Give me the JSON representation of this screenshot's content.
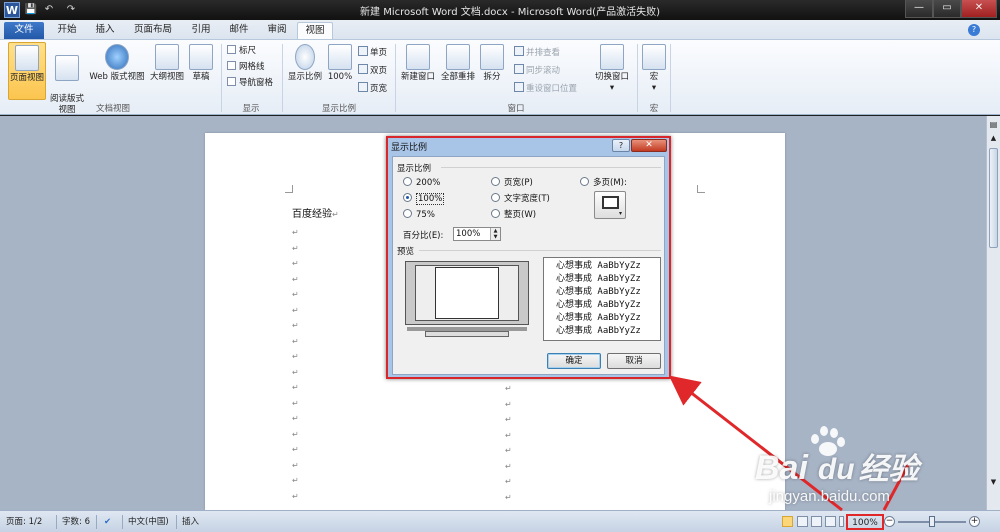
{
  "window": {
    "title": "新建 Microsoft Word 文档.docx - Microsoft Word(产品激活失败)"
  },
  "quick_access": {
    "logo": "W",
    "save": "💾",
    "undo": "↶",
    "redo": "↷"
  },
  "tabs": [
    "文件",
    "开始",
    "插入",
    "页面布局",
    "引用",
    "邮件",
    "审阅",
    "视图"
  ],
  "ribbon": {
    "doc_views": {
      "label": "文档视图",
      "buttons": [
        "页面视图",
        "阅读版式\n视图",
        "Web 版式视图",
        "大纲视图",
        "草稿"
      ]
    },
    "show": {
      "label": "显示",
      "checks": [
        "标尺",
        "网格线",
        "导航窗格"
      ]
    },
    "zoom": {
      "label": "显示比例",
      "zoom_btn": "显示比例",
      "hundred_btn": "100%",
      "small": [
        "单页",
        "双页",
        "页宽"
      ]
    },
    "window": {
      "label": "窗口",
      "buttons": [
        "新建窗口",
        "全部重排",
        "拆分"
      ],
      "small": [
        "并排查看",
        "同步滚动",
        "重设窗口位置"
      ],
      "switch": "切换窗口"
    },
    "macro": {
      "label": "宏",
      "button": "宏"
    }
  },
  "document": {
    "first_line": "百度经验"
  },
  "dialog": {
    "title": "显示比例",
    "help": "?",
    "close": "✕",
    "group_zoom": "显示比例",
    "radios_left": [
      "200%",
      "100%",
      "75%"
    ],
    "radios_mid": [
      "页宽(P)",
      "文字宽度(T)",
      "整页(W)"
    ],
    "radio_right": "多页(M):",
    "percent_label": "百分比(E):",
    "percent_value": "100%",
    "preview_label": "预览",
    "preview_lines": [
      "心想事成 AaBbYyZz",
      "心想事成 AaBbYyZz",
      "心想事成 AaBbYyZz",
      "心想事成 AaBbYyZz",
      "心想事成 AaBbYyZz",
      "心想事成 AaBbYyZz"
    ],
    "ok": "确定",
    "cancel": "取消"
  },
  "status": {
    "page": "页面: 1/2",
    "words": "字数: 6",
    "lang": "中文(中国)",
    "mode": "插入",
    "zoom": "100%"
  },
  "watermark": {
    "brand": "Bai",
    "brand2": "du",
    "brand_cn": "经验",
    "url": "jingyan.baidu.com"
  },
  "colors": {
    "highlight": "#e0282a",
    "accent": "#2b579a"
  }
}
